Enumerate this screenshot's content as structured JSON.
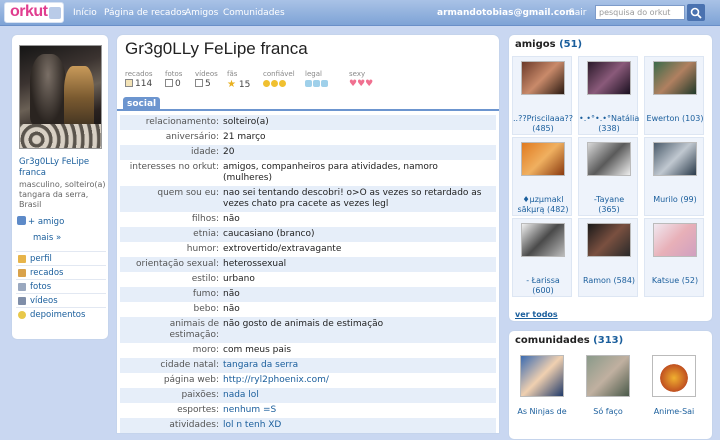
{
  "topbar": {
    "logo": "orkut",
    "nav": [
      "Início",
      "Página de recados",
      "Amigos",
      "Comunidades"
    ],
    "email": "armandotobias@gmail.com",
    "logout": "Sair",
    "search_placeholder": "pesquisa do orkut"
  },
  "profile": {
    "name": "Gr3g0LLy FeLipe franca",
    "short_name": "Gr3g0LLy FeLipe franca",
    "description": "masculino, solteiro(a) tangara da serra, Brasil",
    "add_friend": "+ amigo",
    "more": "mais »",
    "menu": [
      "perfil",
      "recados",
      "fotos",
      "vídeos",
      "depoimentos"
    ]
  },
  "stats": {
    "recados_label": "recados",
    "recados": "114",
    "fotos_label": "fotos",
    "fotos": "0",
    "videos_label": "vídeos",
    "videos": "5",
    "fas_label": "fãs",
    "fas": "15",
    "confiavel_label": "confiável",
    "legal_label": "legal",
    "sexy_label": "sexy",
    "confiavel_level": 3,
    "legal_level": 3,
    "sexy_level": 3
  },
  "tab": "social",
  "social": [
    {
      "label": "relacionamento:",
      "value": "solteiro(a)"
    },
    {
      "label": "aniversário:",
      "value": "21 março"
    },
    {
      "label": "idade:",
      "value": "20"
    },
    {
      "label": "interesses no orkut:",
      "value": "amigos, companheiros para atividades, namoro (mulheres)"
    },
    {
      "label": "quem sou eu:",
      "value": "nao sei tentando descobri! o>O as vezes so retardado as vezes chato pra cacete as vezes legl"
    },
    {
      "label": "filhos:",
      "value": "não"
    },
    {
      "label": "etnia:",
      "value": "caucasiano (branco)"
    },
    {
      "label": "humor:",
      "value": "extrovertido/extravagante"
    },
    {
      "label": "orientação sexual:",
      "value": "heterossexual"
    },
    {
      "label": "estilo:",
      "value": "urbano"
    },
    {
      "label": "fumo:",
      "value": "não"
    },
    {
      "label": "bebo:",
      "value": "não"
    },
    {
      "label": "animais de estimação:",
      "value": "não gosto de animais de estimação"
    },
    {
      "label": "moro:",
      "value": "com meus pais"
    },
    {
      "label": "cidade natal:",
      "value": "tangara da serra"
    },
    {
      "label": "página web:",
      "value": "http://ryl2phoenix.com/"
    },
    {
      "label": "paixões:",
      "value": "nada lol"
    },
    {
      "label": "esportes:",
      "value": "nenhum =S"
    },
    {
      "label": "atividades:",
      "value": "lol n tenh XD"
    }
  ],
  "friends": {
    "title": "amigos",
    "count": "(51)",
    "items": [
      {
        "name": "..??Priscilaaa??",
        "count": "(485)"
      },
      {
        "name": "•.•°•.•°Natália",
        "count": "(338)"
      },
      {
        "name": "Ewerton (103)",
        "count": ""
      },
      {
        "name": "♦µzµmakl sākµrą (482)",
        "count": ""
      },
      {
        "name": "-Tayane",
        "count": "(365)"
      },
      {
        "name": "Murilo (99)",
        "count": ""
      },
      {
        "name": "- Łarissa",
        "count": "(600)"
      },
      {
        "name": "Ramon (584)",
        "count": ""
      },
      {
        "name": "Katsue (52)",
        "count": ""
      }
    ],
    "see_all": "ver todos"
  },
  "communities": {
    "title": "comunidades",
    "count": "(313)",
    "items": [
      "As Ninjas de",
      "Só faço",
      "Anime-Sai"
    ]
  }
}
